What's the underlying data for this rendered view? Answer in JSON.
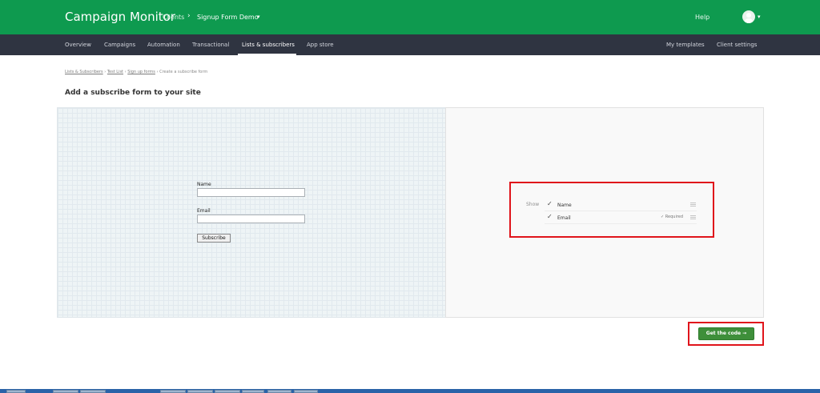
{
  "header": {
    "brand": "Campaign Monitor",
    "clients_label": "Clients",
    "crumb_separator": "›",
    "client_name": "Signup Form Demo",
    "caret": "▾",
    "help_label": "Help"
  },
  "nav": {
    "items": [
      {
        "label": "Overview"
      },
      {
        "label": "Campaigns"
      },
      {
        "label": "Automation"
      },
      {
        "label": "Transactional"
      },
      {
        "label": "Lists & subscribers",
        "active": true
      },
      {
        "label": "App store"
      }
    ],
    "right_items": [
      {
        "label": "My templates"
      },
      {
        "label": "Client settings"
      }
    ]
  },
  "breadcrumb": {
    "items": [
      "Lists & Subscribers",
      "Test List",
      "Sign up forms",
      "Create a subscribe form"
    ],
    "separator": "›"
  },
  "page_title": "Add a subscribe form to your site",
  "preview_form": {
    "name_label": "Name",
    "email_label": "Email",
    "subscribe_label": "Subscribe"
  },
  "field_settings": {
    "show_label": "Show",
    "check_glyph": "✓",
    "fields": [
      {
        "label": "Name",
        "checked": true,
        "required": false
      },
      {
        "label": "Email",
        "checked": true,
        "required": true,
        "required_label": "✓ Required"
      }
    ]
  },
  "get_code_label": "Get the code →",
  "colors": {
    "topbar": "#0e9a4f",
    "nav": "#2f3441",
    "highlight": "#e0141b",
    "primary_button": "#3e8f3a"
  },
  "icons": {
    "avatar": "user-avatar-icon",
    "drag": "drag-handle-icon",
    "check": "checkmark-icon"
  }
}
